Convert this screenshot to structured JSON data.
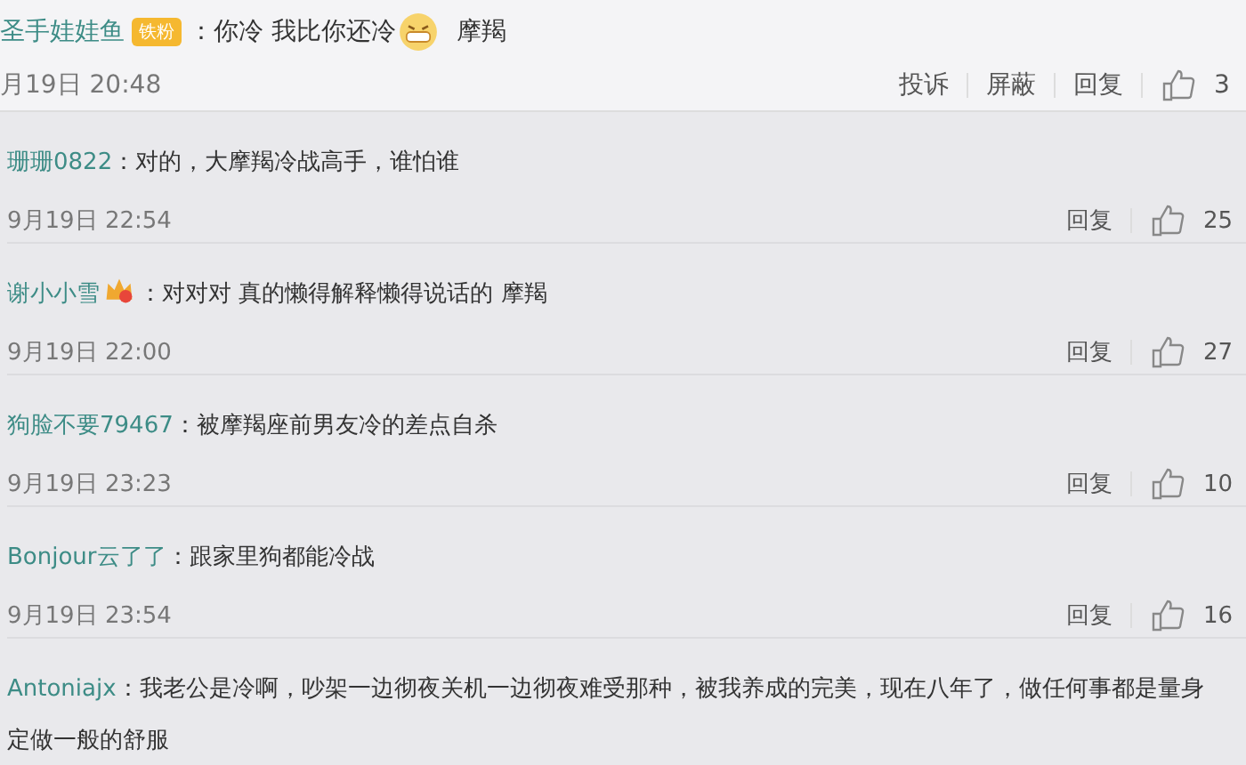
{
  "main_comment": {
    "user": "圣手娃娃鱼",
    "badge": "铁粉",
    "text": "：你冷 我比你还冷",
    "tail": "摩羯",
    "time": "月19日 20:48",
    "actions": [
      "投诉",
      "屏蔽",
      "回复"
    ],
    "likes": "3"
  },
  "replies": [
    {
      "user": "珊珊0822",
      "badge": false,
      "text": "：对的，大摩羯冷战高手，谁怕谁",
      "time": "9月19日 22:54",
      "reply": "回复",
      "likes": "25"
    },
    {
      "user": "谢小小雪",
      "badge": true,
      "text": "：对对对 真的懒得解释懒得说话的 摩羯",
      "time": "9月19日 22:00",
      "reply": "回复",
      "likes": "27"
    },
    {
      "user": "狗脸不要79467",
      "badge": false,
      "text": "：被摩羯座前男友冷的差点自杀",
      "time": "9月19日 23:23",
      "reply": "回复",
      "likes": "10"
    },
    {
      "user": "Bonjour云了了",
      "badge": false,
      "text": "：跟家里狗都能冷战",
      "time": "9月19日 23:54",
      "reply": "回复",
      "likes": "16"
    },
    {
      "user": "Antoniajx",
      "badge": false,
      "text": "：我老公是冷啊，吵架一边彻夜关机一边彻夜难受那种，被我养成的完美，现在八年了，做任何事都是量身定做一般的舒服"
    }
  ]
}
